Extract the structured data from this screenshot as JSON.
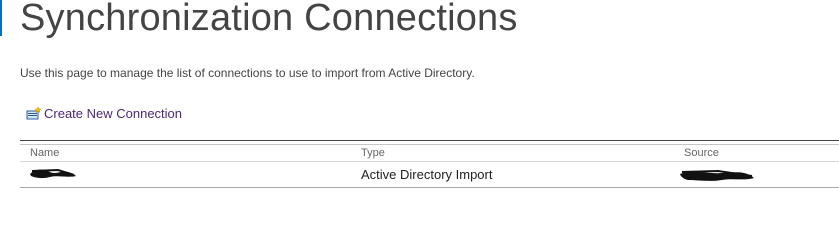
{
  "page": {
    "title": "Synchronization Connections",
    "description": "Use this page to manage the list of connections to use to import from Active Directory."
  },
  "actions": {
    "create_label": "Create New Connection",
    "create_icon": "new-connection-icon"
  },
  "table": {
    "columns": [
      "Name",
      "Type",
      "Source"
    ],
    "rows": [
      {
        "name": "",
        "type": "Active Directory Import",
        "source": ""
      }
    ]
  },
  "colors": {
    "accent": "#0072c6",
    "link": "#4a2a72",
    "title": "#444444"
  }
}
